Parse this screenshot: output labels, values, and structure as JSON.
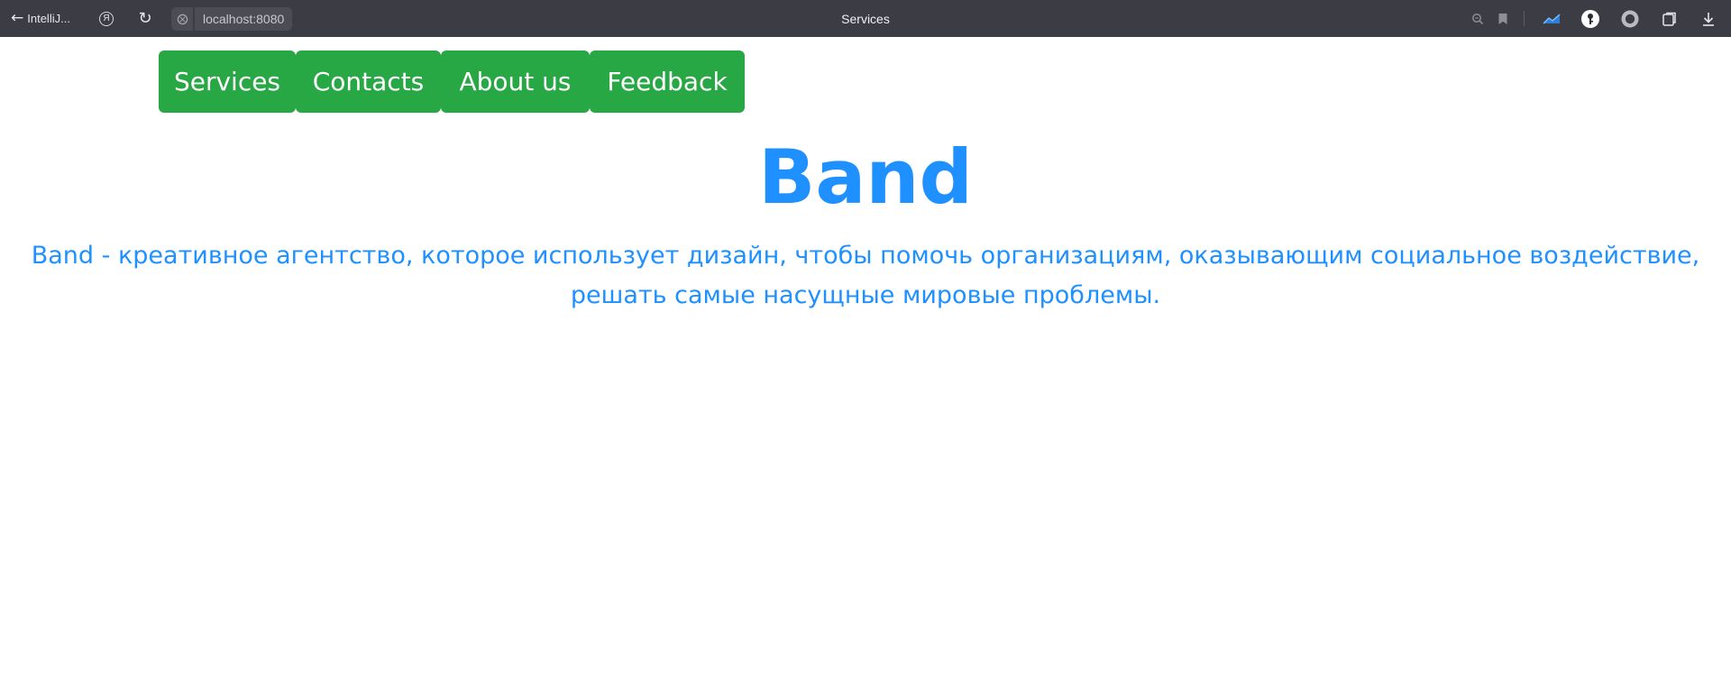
{
  "browser": {
    "back_label": "IntelliJ...",
    "ya_letter": "Я",
    "url": "localhost:8080",
    "tab_title": "Services"
  },
  "nav": {
    "items": [
      {
        "label": "Services"
      },
      {
        "label": "Contacts"
      },
      {
        "label": "About us"
      },
      {
        "label": "Feedback"
      }
    ]
  },
  "main": {
    "heading": "Band",
    "description": "Band - креативное агентство, которое использует дизайн, чтобы помочь организациям, оказывающим социальное воздействие, решать самые насущные мировые проблемы."
  },
  "colors": {
    "accent_green": "#28a745",
    "text_blue": "#1e90ff",
    "chrome_bg": "#3c3c44"
  }
}
